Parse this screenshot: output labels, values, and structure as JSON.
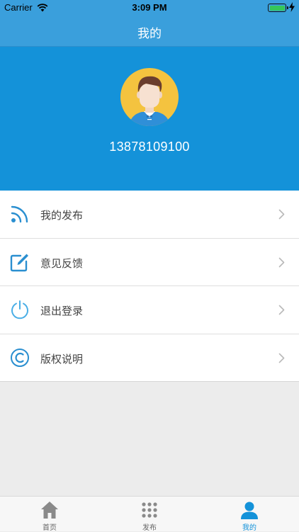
{
  "status_bar": {
    "carrier": "Carrier",
    "time": "3:09 PM"
  },
  "nav": {
    "title": "我的"
  },
  "profile": {
    "phone": "13878109100"
  },
  "menu": {
    "items": [
      {
        "label": "我的发布",
        "icon": "rss-feed-icon"
      },
      {
        "label": "意见反馈",
        "icon": "edit-icon"
      },
      {
        "label": "退出登录",
        "icon": "power-icon"
      },
      {
        "label": "版权说明",
        "icon": "copyright-icon"
      }
    ]
  },
  "tab_bar": {
    "tabs": [
      {
        "label": "首页",
        "icon": "home-icon"
      },
      {
        "label": "发布",
        "icon": "grid-icon"
      },
      {
        "label": "我的",
        "icon": "person-icon",
        "active": true
      }
    ]
  },
  "colors": {
    "nav_bg": "#3a9fdc",
    "profile_bg": "#1492d9",
    "accent": "#1492d9",
    "icon_blue": "#2a8fd0",
    "page_bg": "#ececec"
  }
}
